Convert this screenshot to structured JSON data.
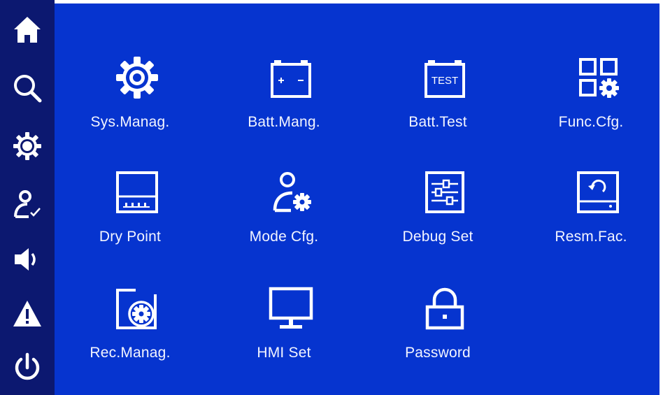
{
  "sidebar": {
    "items": [
      {
        "icon": "home-icon"
      },
      {
        "icon": "search-icon"
      },
      {
        "icon": "gear-icon"
      },
      {
        "icon": "user-check-icon"
      },
      {
        "icon": "speaker-icon"
      },
      {
        "icon": "warning-icon"
      },
      {
        "icon": "power-icon"
      }
    ]
  },
  "menu": {
    "items": [
      {
        "label": "Sys.Manag.",
        "icon": "gear-icon"
      },
      {
        "label": "Batt.Mang.",
        "icon": "battery-icon"
      },
      {
        "label": "Batt.Test",
        "icon": "battery-test-icon",
        "icon_text": "TEST"
      },
      {
        "label": "Func.Cfg.",
        "icon": "grid-gear-icon"
      },
      {
        "label": "Dry Point",
        "icon": "dry-contact-icon"
      },
      {
        "label": "Mode Cfg.",
        "icon": "user-gear-icon"
      },
      {
        "label": "Debug Set",
        "icon": "sliders-icon"
      },
      {
        "label": "Resm.Fac.",
        "icon": "factory-reset-icon"
      },
      {
        "label": "Rec.Manag.",
        "icon": "record-gear-icon"
      },
      {
        "label": "HMI Set",
        "icon": "monitor-icon"
      },
      {
        "label": "Password",
        "icon": "lock-icon"
      }
    ]
  },
  "colors": {
    "sidebar_bg": "#0c1870",
    "main_bg": "#0634cf",
    "icon_fg": "#ffffff"
  }
}
